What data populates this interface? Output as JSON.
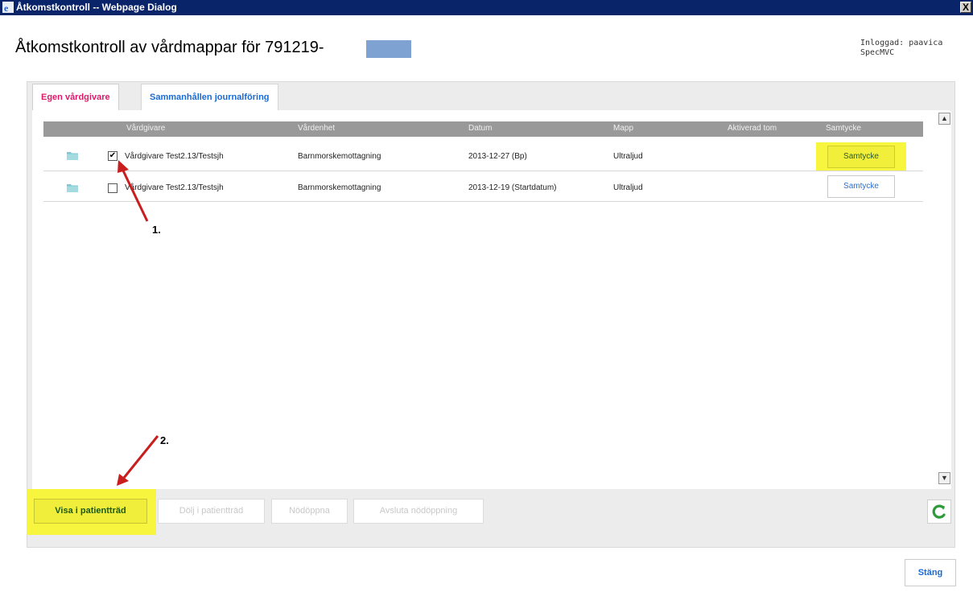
{
  "window": {
    "title": "Åtkomstkontroll -- Webpage Dialog",
    "close_glyph": "X"
  },
  "header": {
    "page_title": "Åtkomstkontroll av vårdmappar för 791219-",
    "user_line1": "Inloggad: paavica",
    "user_line2": "SpecMVC"
  },
  "tabs": [
    {
      "label": "Egen vårdgivare",
      "active": true
    },
    {
      "label": "Sammanhållen journalföring",
      "active": false
    }
  ],
  "table": {
    "columns": [
      "Vårdgivare",
      "Vårdenhet",
      "Datum",
      "Mapp",
      "Aktiverad tom",
      "Samtycke"
    ],
    "rows": [
      {
        "checked": "✔",
        "vardgivare": "Vårdgivare Test2.13/Testsjh",
        "vardenhet": "Barnmorskemottagning",
        "datum": "2013-12-27 (Bp)",
        "mapp": "Ultraljud",
        "aktiverad_tom": "",
        "samtycke": "Samtycke"
      },
      {
        "checked": "",
        "vardgivare": "Vårdgivare Test2.13/Testsjh",
        "vardenhet": "Barnmorskemottagning",
        "datum": "2013-12-19 (Startdatum)",
        "mapp": "Ultraljud",
        "aktiverad_tom": "",
        "samtycke": "Samtycke"
      }
    ]
  },
  "annotations": {
    "step1": "1.",
    "step2": "2."
  },
  "actions": {
    "visa": "Visa i patientträd",
    "dolj": "Dölj i patientträd",
    "nodoppna": "Nödöppna",
    "avsluta": "Avsluta nödöppning"
  },
  "footer": {
    "close_label": "Stäng"
  },
  "scrollbar": {
    "up_glyph": "▲",
    "down_glyph": "▼"
  },
  "colors": {
    "highlight": "#f7f53d",
    "title_bar": "#0a246a",
    "active_tab": "#e0196a",
    "link_blue": "#1a6ad6",
    "annotation_arrow": "#c81e1e",
    "refresh_green": "#2e9b3a"
  }
}
